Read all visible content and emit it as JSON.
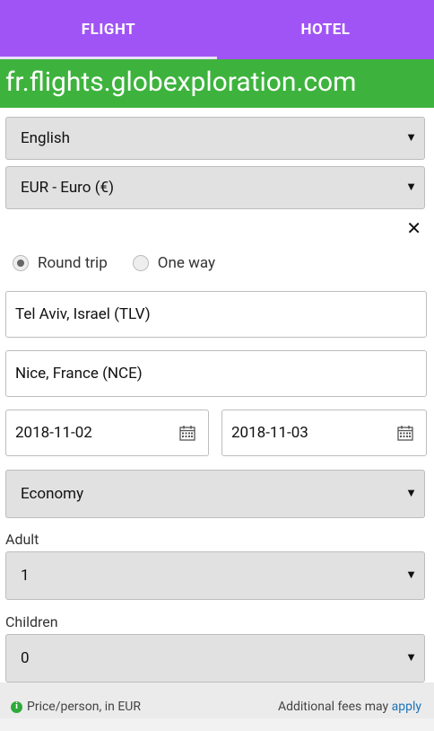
{
  "tabs": [
    {
      "label": "FLIGHT",
      "active": true
    },
    {
      "label": "HOTEL",
      "active": false
    }
  ],
  "banner": {
    "text": "fr.flights.globexploration.com"
  },
  "language": {
    "value": "English"
  },
  "currency": {
    "value": "EUR - Euro (€)"
  },
  "trip_type": {
    "round_trip": "Round trip",
    "one_way": "One way",
    "selected": "Round trip"
  },
  "origin": {
    "value": "Tel Aviv, Israel (TLV)"
  },
  "destination": {
    "value": "Nice, France (NCE)"
  },
  "depart_date": {
    "value": "2018-11-02"
  },
  "return_date": {
    "value": "2018-11-03"
  },
  "cabin_class": {
    "value": "Economy"
  },
  "adults": {
    "label": "Adult",
    "value": "1"
  },
  "children": {
    "label": "Children",
    "value": "0"
  },
  "footer": {
    "price_note": "Price/person, in EUR",
    "fees_text": "Additional fees may",
    "fees_link": "apply"
  },
  "colors": {
    "tab_bar": "#a054f5",
    "banner": "#3db33d",
    "link": "#1a73b8"
  }
}
